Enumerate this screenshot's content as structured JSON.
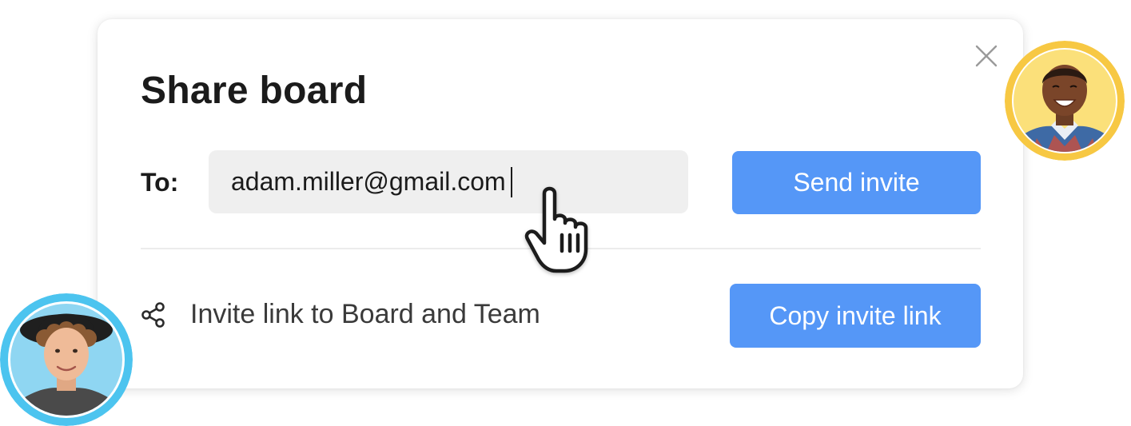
{
  "dialog": {
    "title": "Share board",
    "to_label": "To:",
    "email_value": "adam.miller@gmail.com",
    "send_button_label": "Send invite",
    "invite_link_text": "Invite link to Board and Team",
    "copy_button_label": "Copy invite link",
    "close_icon": "close-icon",
    "share_icon": "share-icon"
  },
  "cursor": {
    "icon": "hand-pointer-icon"
  },
  "avatars": {
    "right": {
      "ring_color": "#f7c843"
    },
    "left": {
      "ring_color": "#4cc4ef"
    }
  },
  "colors": {
    "accent": "#5597f7",
    "input_bg": "#efefef",
    "text": "#1b1b1b"
  }
}
